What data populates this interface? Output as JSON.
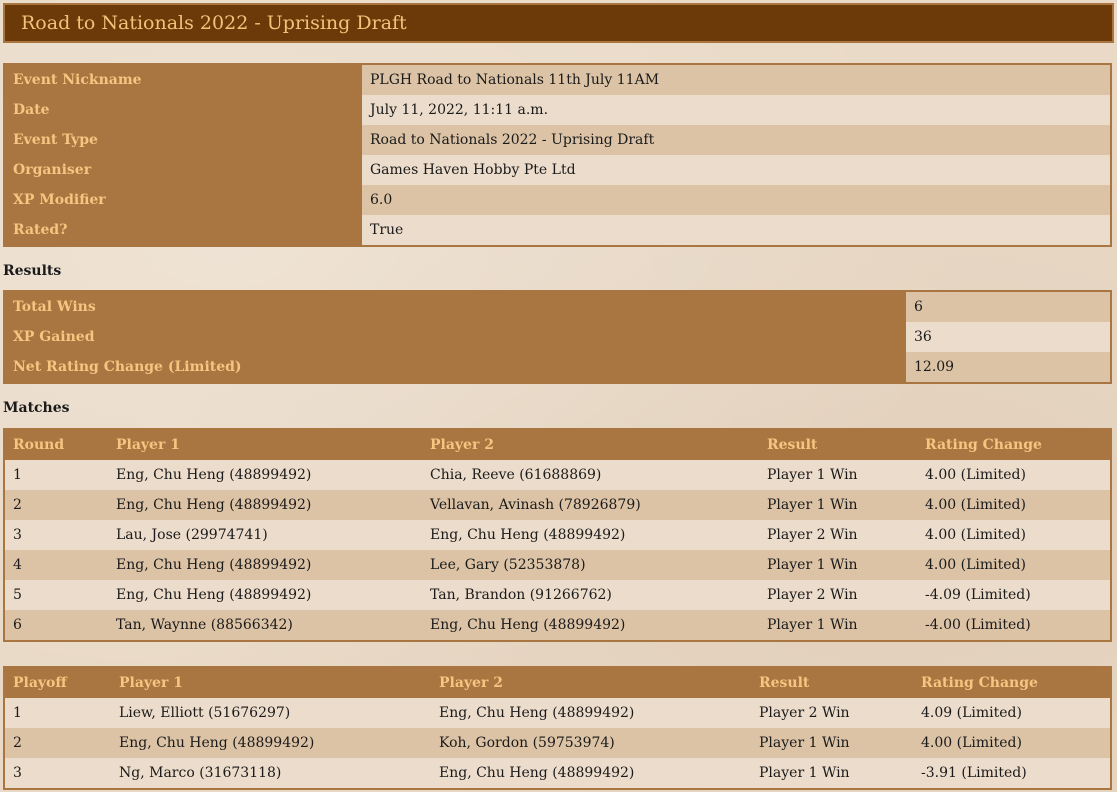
{
  "title": "Road to Nationals 2022 - Uprising Draft",
  "details": [
    {
      "label": "Event Nickname",
      "value": "PLGH Road to Nationals 11th July 11AM"
    },
    {
      "label": "Date",
      "value": "July 11, 2022, 11:11 a.m."
    },
    {
      "label": "Event Type",
      "value": "Road to Nationals 2022 - Uprising Draft"
    },
    {
      "label": "Organiser",
      "value": "Games Haven Hobby Pte Ltd"
    },
    {
      "label": "XP Modifier",
      "value": "6.0"
    },
    {
      "label": "Rated?",
      "value": "True"
    }
  ],
  "results_heading": "Results",
  "results": [
    {
      "label": "Total Wins",
      "value": "6"
    },
    {
      "label": "XP Gained",
      "value": "36"
    },
    {
      "label": "Net Rating Change (Limited)",
      "value": "12.09"
    }
  ],
  "matches_heading": "Matches",
  "matches": {
    "headers": [
      "Round",
      "Player 1",
      "Player 2",
      "Result",
      "Rating Change"
    ],
    "rows": [
      [
        "1",
        "Eng, Chu Heng (48899492)",
        "Chia, Reeve (61688869)",
        "Player 1 Win",
        "4.00 (Limited)"
      ],
      [
        "2",
        "Eng, Chu Heng (48899492)",
        "Vellavan, Avinash (78926879)",
        "Player 1 Win",
        "4.00 (Limited)"
      ],
      [
        "3",
        "Lau, Jose (29974741)",
        "Eng, Chu Heng (48899492)",
        "Player 2 Win",
        "4.00 (Limited)"
      ],
      [
        "4",
        "Eng, Chu Heng (48899492)",
        "Lee, Gary (52353878)",
        "Player 1 Win",
        "4.00 (Limited)"
      ],
      [
        "5",
        "Eng, Chu Heng (48899492)",
        "Tan, Brandon (91266762)",
        "Player 2 Win",
        "-4.09 (Limited)"
      ],
      [
        "6",
        "Tan, Waynne (88566342)",
        "Eng, Chu Heng (48899492)",
        "Player 1 Win",
        "-4.00 (Limited)"
      ]
    ]
  },
  "playoffs": {
    "headers": [
      "Playoff",
      "Player 1",
      "Player 2",
      "Result",
      "Rating Change"
    ],
    "rows": [
      [
        "1",
        "Liew, Elliott (51676297)",
        "Eng, Chu Heng (48899492)",
        "Player 2 Win",
        "4.09 (Limited)"
      ],
      [
        "2",
        "Eng, Chu Heng (48899492)",
        "Koh, Gordon (59753974)",
        "Player 1 Win",
        "4.00 (Limited)"
      ],
      [
        "3",
        "Ng, Marco (31673118)",
        "Eng, Chu Heng (48899492)",
        "Player 1 Win",
        "-3.91 (Limited)"
      ]
    ]
  }
}
